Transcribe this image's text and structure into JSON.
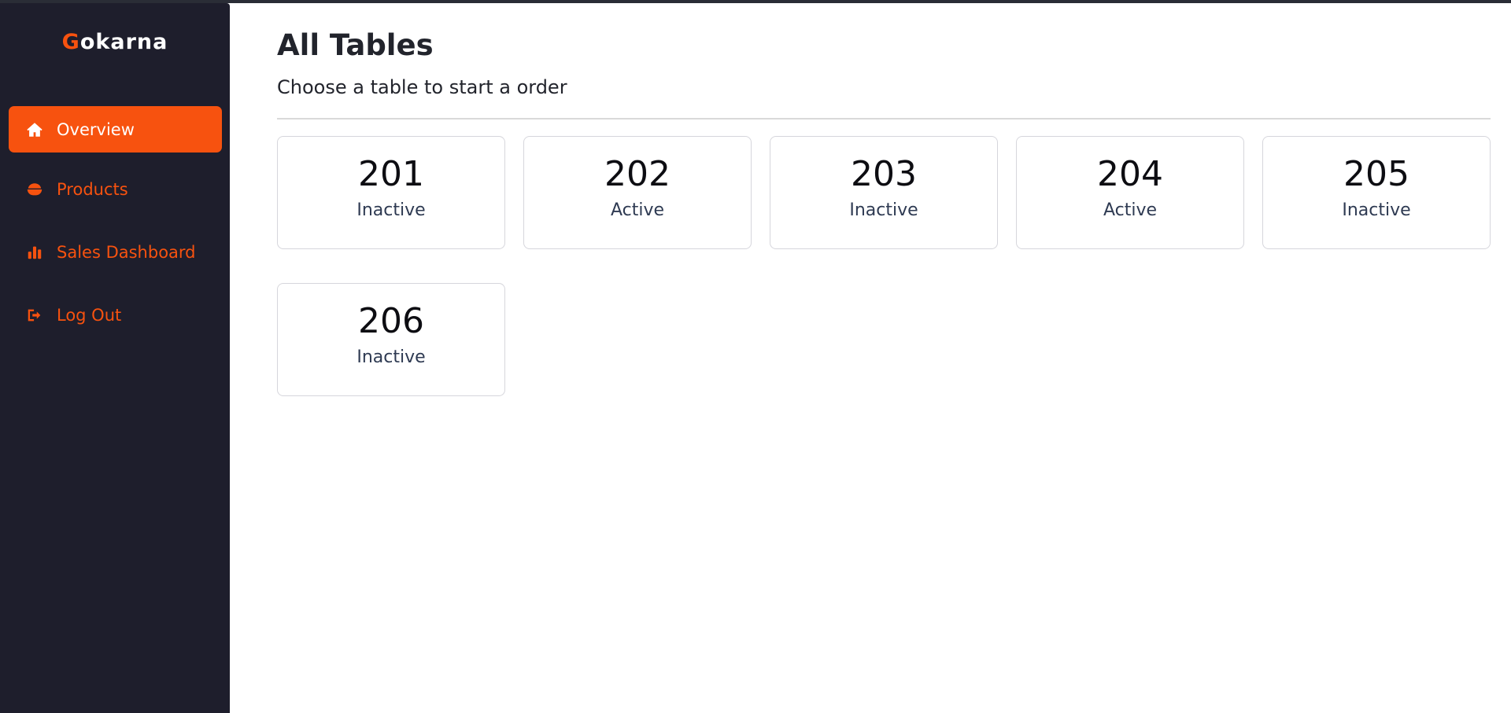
{
  "brand": {
    "first_letter": "G",
    "rest": "okarna"
  },
  "sidebar": {
    "items": [
      {
        "label": "Overview",
        "icon": "home-icon",
        "active": true
      },
      {
        "label": "Products",
        "icon": "bowl-icon",
        "active": false
      },
      {
        "label": "Sales Dashboard",
        "icon": "bar-chart-icon",
        "active": false
      },
      {
        "label": "Log Out",
        "icon": "logout-icon",
        "active": false
      }
    ]
  },
  "main": {
    "title": "All Tables",
    "subtitle": "Choose a table to start a order",
    "tables": [
      {
        "number": "201",
        "status": "Inactive"
      },
      {
        "number": "202",
        "status": "Active"
      },
      {
        "number": "203",
        "status": "Inactive"
      },
      {
        "number": "204",
        "status": "Active"
      },
      {
        "number": "205",
        "status": "Inactive"
      },
      {
        "number": "206",
        "status": "Inactive"
      }
    ]
  },
  "colors": {
    "accent": "#f7520f",
    "sidebar_bg": "#1e1e2c",
    "status_text": "#2e3a52"
  }
}
